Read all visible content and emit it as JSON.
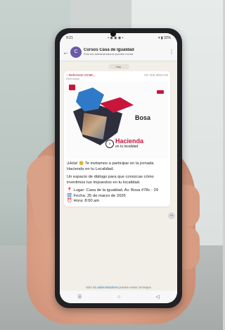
{
  "status": {
    "time": "9:21",
    "icons": "▪ ◉ ◉ ◉ •",
    "battery": "▾ ▮ 32%"
  },
  "chat": {
    "title": "Cursos Casa de Igualdad",
    "subtitle": "Solo los administradores pueden enviar",
    "date_chip": "Hoy",
    "avatar_letter": "C"
  },
  "message": {
    "forwarded": "Reenviado",
    "sender": "~ Referente OCMI...",
    "phone": "+57 305 8001745",
    "flyer": {
      "place": "Bosa",
      "title": "Hacienda",
      "subtitle": "en tu localidad"
    },
    "para1": "¡Hola! 😊 Te invitamos a participar en la jornada Hacienda en tu Localidad.",
    "para2": "Un espacio de diálogo para que conozcas cómo invertimos tus impuestos en tu localidad.",
    "place_line": "Lugar: Casa de la igualdad, Av. Bosa #78c - 29",
    "date_line": "Fecha: 25 de marzo de 2026",
    "time_line": "Hora: 8:00 am"
  },
  "footer": {
    "note_prefix": "Solo los",
    "note_link": "administradores",
    "note_suffix": "pueden enviar mensajes"
  },
  "nav": {
    "recent": "☰",
    "home": "○",
    "back": "◁"
  }
}
